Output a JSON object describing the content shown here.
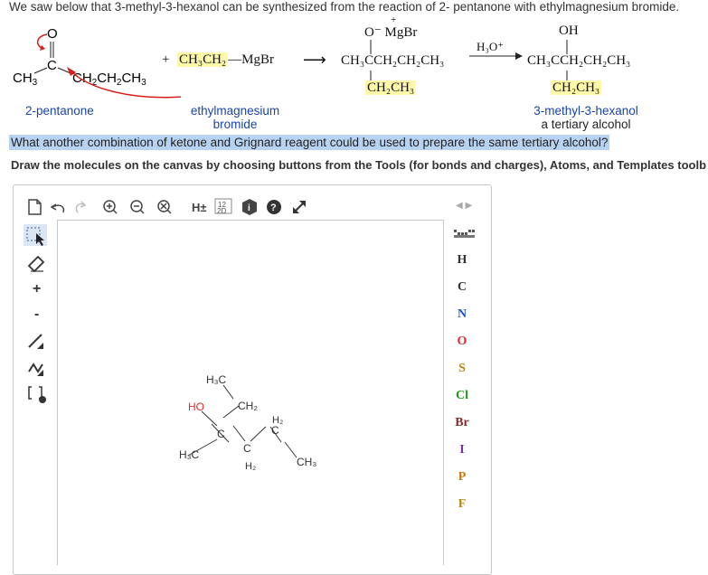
{
  "intro": "We saw below that 3-methyl-3-hexanol can be synthesized from the reaction of 2- pentanone with ethylmagnesium bromide.",
  "reaction": {
    "ketone": {
      "o": "O",
      "c": "C",
      "ch3": "CH",
      "ch3_sub": "3",
      "chain": "CH",
      "chain_sub1": "2",
      "chain_mid": "CH",
      "chain_sub2": "2",
      "chain_end": "CH",
      "chain_sub3": "3"
    },
    "plus": "+",
    "grignard": "CH₃CH₂",
    "grignard_bond": "—",
    "mgbr": "MgBr",
    "arrow1": "⟶",
    "intermediate_top": "O⁻ MgBr",
    "intermediate_plus": "+",
    "intermediate_main": "CH₃CCH₂CH₂CH₃",
    "intermediate_sub": "CH₂CH₃",
    "reagent": "H₃O⁺",
    "product_top": "OH",
    "product_main": "CH₃CCH₂CH₂CH₃",
    "product_sub": "CH₂CH₃"
  },
  "captions": {
    "ketone": "2-pentanone",
    "grignard_line1": "ethylmagnesium",
    "grignard_line2": "bromide",
    "product_line1": "3-methyl-3-hexanol",
    "product_line2": "a tertiary alcohol"
  },
  "question": "What another combination of ketone and Grignard reagent could be used to prepare the same tertiary alcohol?",
  "instructions": "Draw the molecules on the canvas by choosing buttons from the Tools (for bonds and charges), Atoms, and Templates toolb",
  "toolbar": {
    "h_toggle": "H±",
    "two_d": "2D",
    "two_d_num": "12"
  },
  "atoms": [
    "H",
    "C",
    "N",
    "O",
    "S",
    "Cl",
    "Br",
    "I",
    "P",
    "F"
  ],
  "atom_colors": [
    "#333333",
    "#333333",
    "#1f4fd1",
    "#e02b2b",
    "#b8860b",
    "#1c9c1c",
    "#8b2a2a",
    "#7a2aa8",
    "#c7790a",
    "#b8860b"
  ],
  "canvas_molecule": {
    "ho": "HO",
    "h3c_top": "H₃C",
    "ch2_a": "CH₂",
    "c_center": "C",
    "h3c_left": "H₃C",
    "c_mid": "C",
    "h2_mid": "H₂",
    "h2_top": "H₂",
    "c_right": "C",
    "ch3_right": "CH₃"
  }
}
